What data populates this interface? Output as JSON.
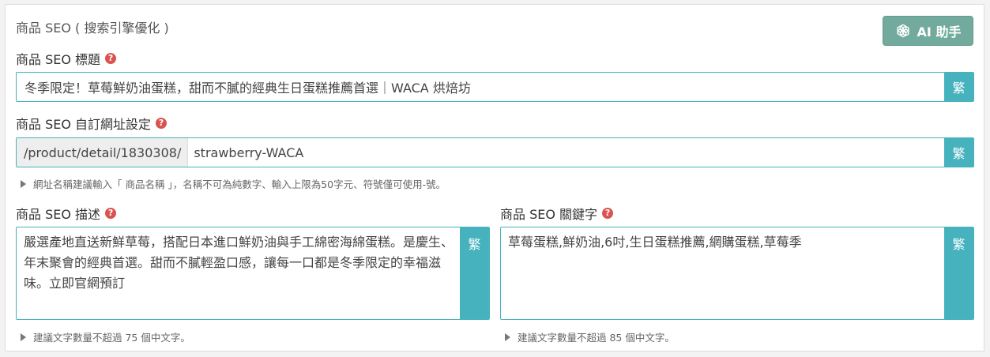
{
  "section_title": "商品 SEO ( 搜索引擎優化 )",
  "ai_button": {
    "label": "AI 助手",
    "icon": "openai-icon"
  },
  "seo_title": {
    "label": "商品 SEO 標題",
    "help": "?",
    "value": "冬季限定！草莓鮮奶油蛋糕，甜而不膩的經典生日蛋糕推薦首選｜WACA 烘焙坊",
    "trad_button": "繁"
  },
  "seo_url": {
    "label": "商品 SEO 自訂網址設定",
    "help": "?",
    "prefix": "/product/detail/1830308/",
    "value": "strawberry-WACA",
    "trad_button": "繁",
    "hint": "網址名稱建議輸入「 商品名稱 」，名稱不可為純數字、輸入上限為50字元、符號僅可使用-號。"
  },
  "seo_description": {
    "label": "商品 SEO 描述",
    "help": "?",
    "value": "嚴選產地直送新鮮草莓，搭配日本進口鮮奶油與手工綿密海綿蛋糕。是慶生、年末聚會的經典首選。甜而不膩輕盈口感，讓每一口都是冬季限定的幸福滋味。立即官網預訂",
    "trad_button": "繁",
    "hint": "建議文字數量不超過 75 個中文字。"
  },
  "seo_keywords": {
    "label": "商品 SEO 關鍵字",
    "help": "?",
    "value": "草莓蛋糕,鮮奶油,6吋,生日蛋糕推薦,網購蛋糕,草莓季",
    "trad_button": "繁",
    "hint": "建議文字數量不超過 85 個中文字。"
  },
  "colors": {
    "accent": "#45b2bd",
    "ai_button": "#72ab9e",
    "help_icon": "#d9534f"
  }
}
